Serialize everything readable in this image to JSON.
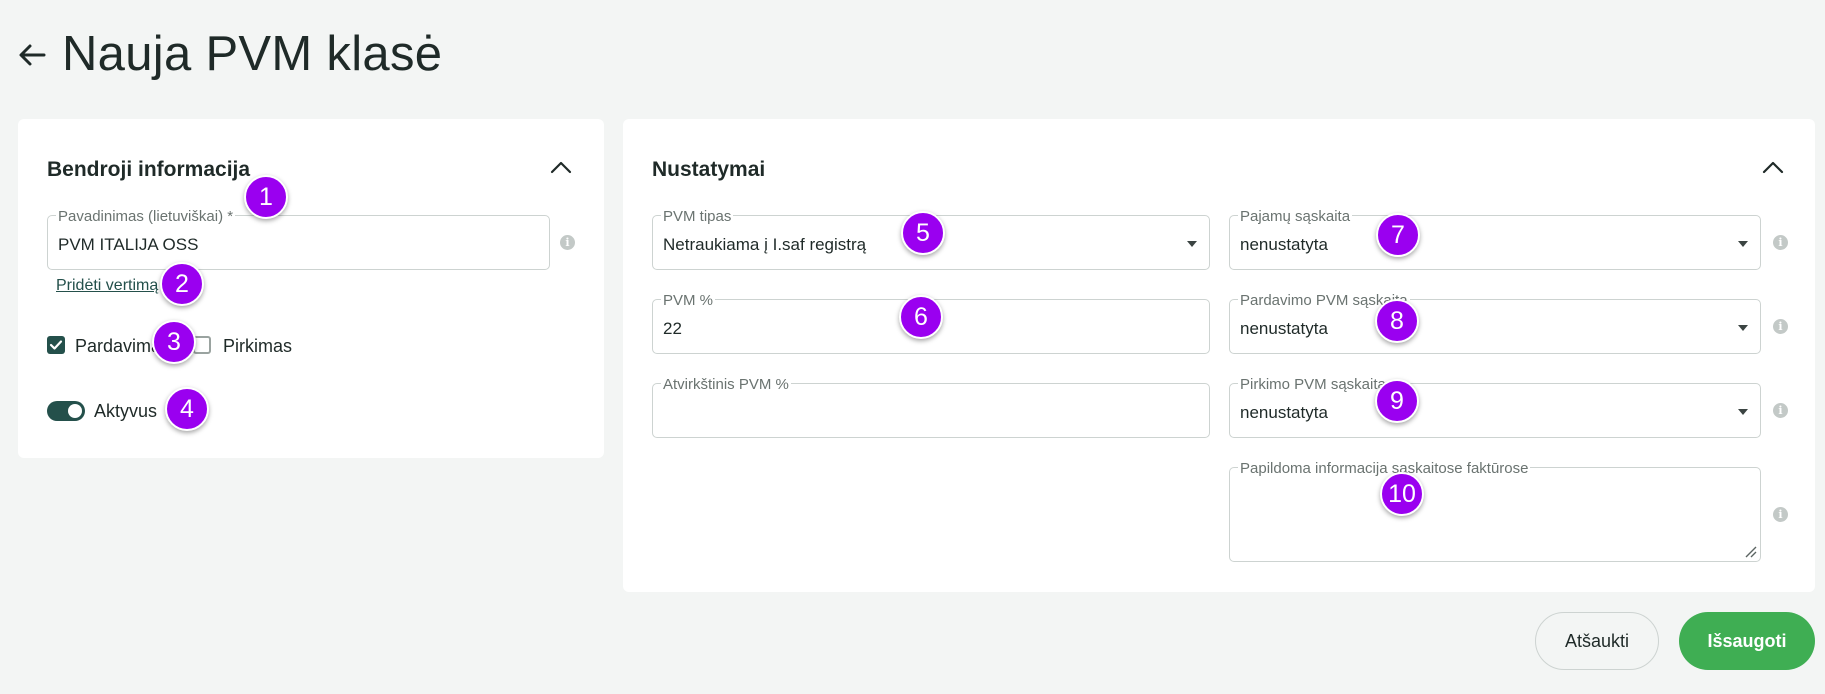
{
  "header": {
    "title": "Nauja PVM klasė"
  },
  "general": {
    "title": "Bendroji informacija",
    "name_field": {
      "label": "Pavadinimas (lietuviškai)",
      "required_mark": "*",
      "value": "PVM ITALIJA OSS"
    },
    "add_translation_link": "Pridėti vertimą",
    "sale_checkbox": {
      "label": "Pardavimas",
      "checked": true
    },
    "purchase_checkbox": {
      "label": "Pirkimas",
      "checked": false
    },
    "active_toggle": {
      "label": "Aktyvus",
      "on": true
    }
  },
  "settings": {
    "title": "Nustatymai",
    "vat_type": {
      "label": "PVM tipas",
      "value": "Netraukiama į I.saf registrą"
    },
    "vat_percent": {
      "label": "PVM %",
      "value": "22"
    },
    "reverse_vat_percent": {
      "label": "Atvirkštinis PVM %",
      "value": ""
    },
    "income_account": {
      "label": "Pajamų sąskaita",
      "value": "nenustatyta"
    },
    "sale_vat_account": {
      "label": "Pardavimo PVM sąskaita",
      "value": "nenustatyta"
    },
    "purchase_vat_account": {
      "label": "Pirkimo PVM sąskaita",
      "value": "nenustatyta"
    },
    "invoice_extra_info": {
      "label": "Papildoma informacija sąskaitose faktūrose",
      "value": ""
    }
  },
  "info_icon_glyph": "i",
  "markers": [
    "1",
    "2",
    "3",
    "4",
    "5",
    "6",
    "7",
    "8",
    "9",
    "10"
  ],
  "actions": {
    "cancel_label": "Atšaukti",
    "save_label": "Išsaugoti"
  },
  "colors": {
    "accent": "#24504b",
    "save": "#3fae53",
    "marker": "#9a00f0"
  }
}
